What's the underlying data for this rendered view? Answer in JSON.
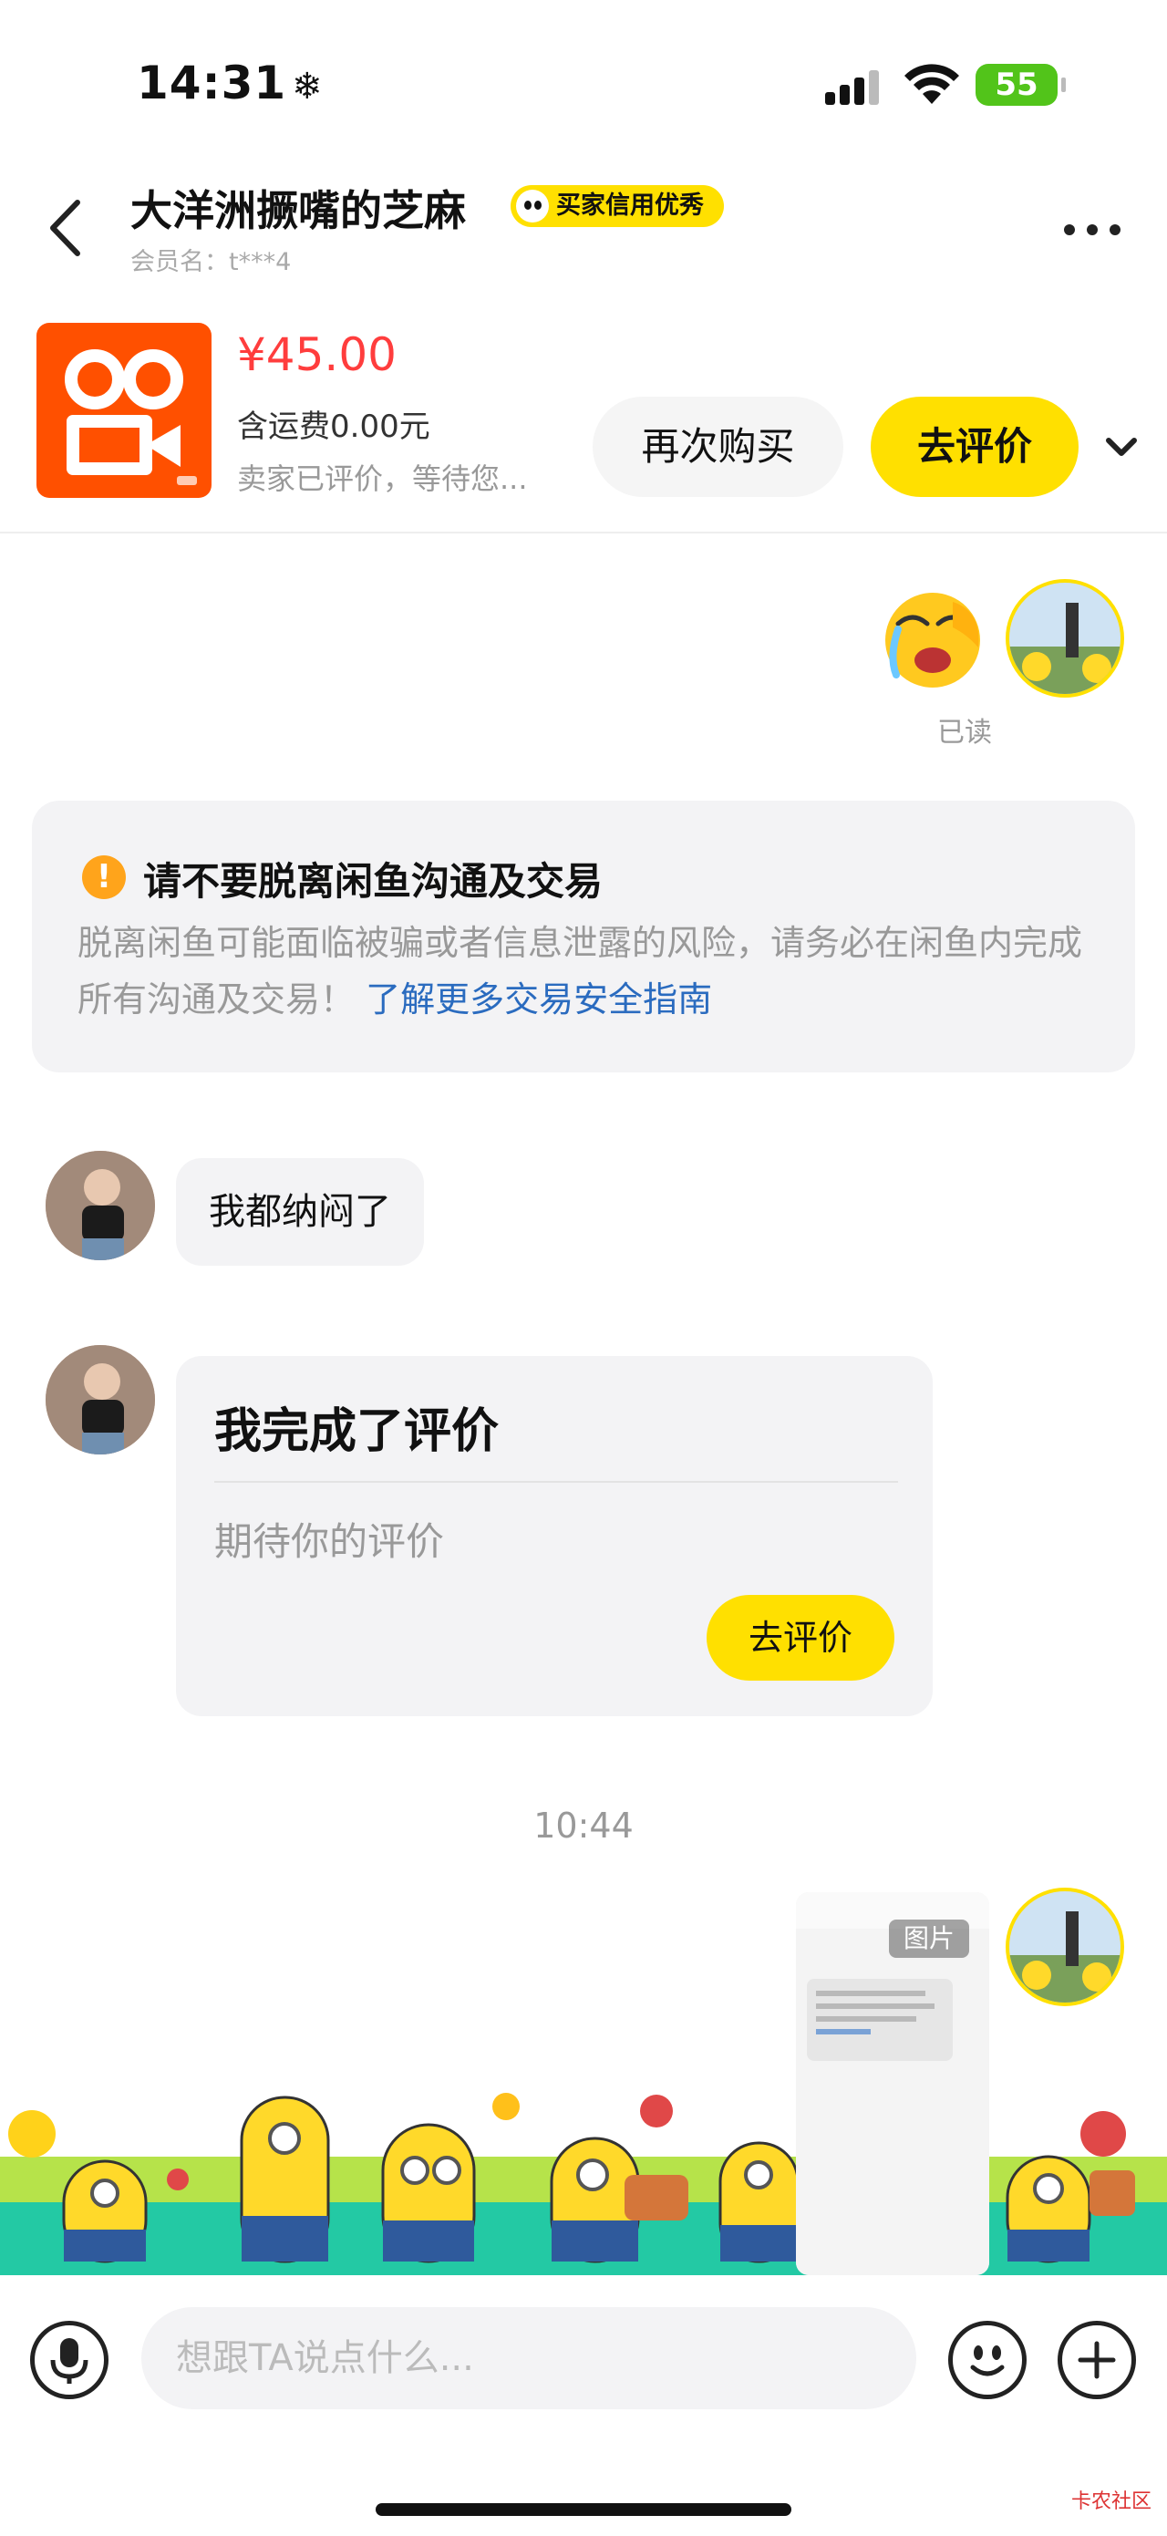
{
  "status_bar": {
    "time": "14:31",
    "time_icon": "snowflake-icon",
    "battery": "55"
  },
  "header": {
    "title": "大洋洲撅嘴的芝麻",
    "credit_badge": "买家信用优秀",
    "member_name": "会员名：t***4"
  },
  "order": {
    "price": "¥45.00",
    "shipping": "含运费0.00元",
    "status": "卖家已评价，等待您...",
    "rebuy_label": "再次购买",
    "review_label": "去评价",
    "thumb_color": "#ff5000"
  },
  "chat": {
    "read_label": "已读",
    "notice": {
      "title": "请不要脱离闲鱼沟通及交易",
      "body": "脱离闲鱼可能面临被骗或者信息泄露的风险，请务必在闲鱼内完成所有沟通及交易！",
      "link": "了解更多交易安全指南"
    },
    "text_message": "我都纳闷了",
    "review_card": {
      "title": "我完成了评价",
      "subtitle": "期待你的评价",
      "button": "去评价"
    },
    "time_separator": "10:44",
    "image_label": "图片"
  },
  "input": {
    "placeholder": "想跟TA说点什么..."
  },
  "watermark": "卡农社区",
  "colors": {
    "accent": "#ffe000",
    "price": "#ff3d3d",
    "link": "#2a6bbf"
  }
}
